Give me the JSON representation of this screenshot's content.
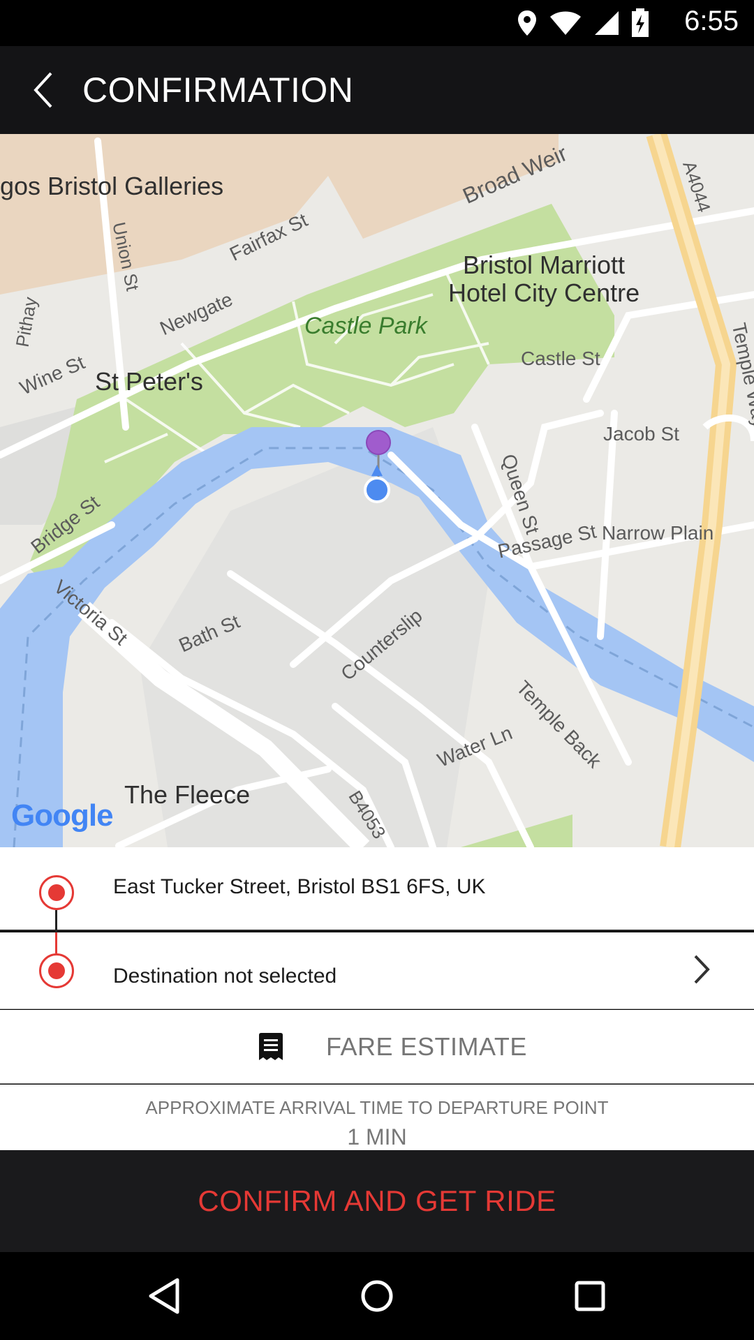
{
  "status_bar": {
    "time": "6:55",
    "icons": [
      "location-icon",
      "wifi-icon",
      "signal-icon",
      "battery-charging-icon"
    ]
  },
  "app_bar": {
    "title": "CONFIRMATION",
    "back_icon": "chevron-left-icon"
  },
  "map": {
    "labels": {
      "galleries": "gos Bristol Galleries",
      "broad_weir": "Broad Weir",
      "a4044": "A4044",
      "union_st": "Union St",
      "fairfax_st": "Fairfax St",
      "marriott": "Bristol Marriott\nHotel City Centre",
      "pithay": "Pithay",
      "newgate": "Newgate",
      "castle_park": "Castle Park",
      "temple_way": "Temple Way Underpass",
      "castle_st": "Castle St",
      "wine_st": "Wine St",
      "st_peters": "St Peter's",
      "jacob_st": "Jacob St",
      "queen_st": "Queen St",
      "bridge_st": "Bridge St",
      "passage_st": "Passage St",
      "narrow_plain": "Narrow Plain",
      "victoria_st": "Victoria St",
      "bath_st": "Bath St",
      "counterslip": "Counterslip",
      "temple_back": "Temple Back",
      "water_ln": "Water Ln",
      "the_fleece": "The Fleece",
      "b4053": "B4053"
    },
    "attribution": "Google"
  },
  "ride": {
    "pickup_address": "East Tucker Street, Bristol BS1 6FS, UK",
    "destination": "Destination not selected",
    "fare_label": "FARE ESTIMATE",
    "eta_caption": "APPROXIMATE ARRIVAL TIME TO DEPARTURE POINT",
    "eta_value": "1 MIN",
    "confirm_label": "CONFIRM AND GET RIDE"
  },
  "colors": {
    "accent": "#e53935",
    "app_bar": "#141416",
    "water": "#a4c5f4",
    "park": "#c4dfa0"
  }
}
